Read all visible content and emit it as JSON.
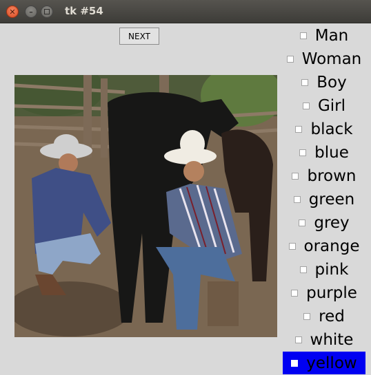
{
  "window": {
    "title": "tk #54"
  },
  "toolbar": {
    "next_label": "NEXT"
  },
  "photo": {
    "subject": "photo"
  },
  "checklist": {
    "items": [
      {
        "label": "Man",
        "checked": false
      },
      {
        "label": "Woman",
        "checked": false
      },
      {
        "label": "Boy",
        "checked": false
      },
      {
        "label": "Girl",
        "checked": false
      },
      {
        "label": "black",
        "checked": false
      },
      {
        "label": "blue",
        "checked": false
      },
      {
        "label": "brown",
        "checked": false
      },
      {
        "label": "green",
        "checked": false
      },
      {
        "label": "grey",
        "checked": false
      },
      {
        "label": "orange",
        "checked": false
      },
      {
        "label": "pink",
        "checked": false
      },
      {
        "label": "purple",
        "checked": false
      },
      {
        "label": "red",
        "checked": false
      },
      {
        "label": "white",
        "checked": false
      },
      {
        "label": "yellow",
        "checked": false,
        "highlighted": true
      }
    ]
  },
  "colors": {
    "highlight": "#0000f2",
    "background": "#d9d9d9",
    "titlebar": "#3d3c38"
  },
  "icons": {
    "close": "close-icon",
    "minimize": "minimize-icon",
    "maximize": "maximize-icon"
  }
}
